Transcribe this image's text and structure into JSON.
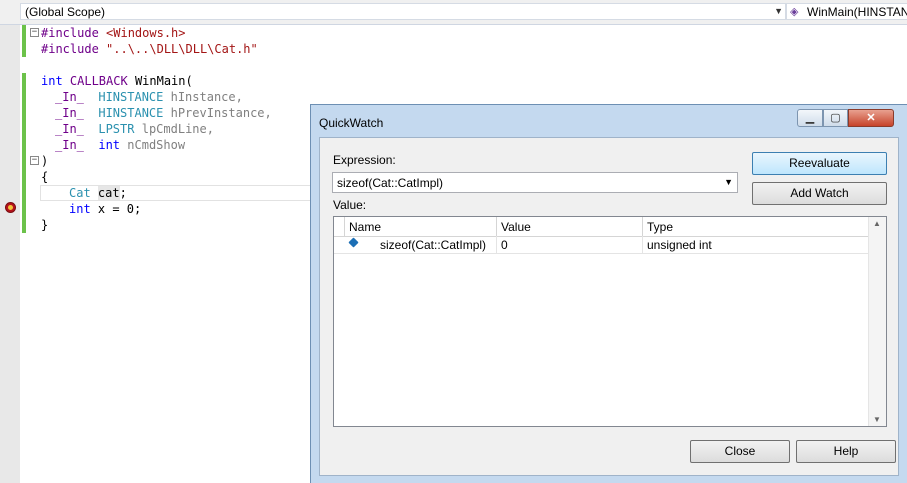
{
  "navbar": {
    "scope": "(Global Scope)",
    "function": "WinMain(HINSTAN"
  },
  "code": {
    "lines": [
      [
        "#include ",
        "<Windows.h>"
      ],
      [
        "#include ",
        "\"..\\..\\DLL\\DLL\\Cat.h\""
      ],
      [
        "int ",
        "CALLBACK ",
        "WinMain("
      ],
      [
        "_In_  ",
        "HINSTANCE ",
        "hInstance,"
      ],
      [
        "_In_  ",
        "HINSTANCE ",
        "hPrevInstance,"
      ],
      [
        "_In_  ",
        "LPSTR ",
        "lpCmdLine,"
      ],
      [
        "_In_  ",
        "int ",
        "nCmdShow"
      ],
      [
        ")"
      ],
      [
        "{"
      ],
      [
        "Cat ",
        "cat",
        ";"
      ],
      [
        "int ",
        "x = 0;"
      ],
      [
        "}"
      ]
    ]
  },
  "quickwatch": {
    "title": "QuickWatch",
    "expression_label": "Expression:",
    "expression_value": "sizeof(Cat::CatImpl)",
    "value_label": "Value:",
    "reevaluate": "Reevaluate",
    "add_watch": "Add Watch",
    "close": "Close",
    "help": "Help",
    "columns": [
      "Name",
      "Value",
      "Type"
    ],
    "rows": [
      {
        "name": "sizeof(Cat::CatImpl)",
        "value": "0",
        "type": "unsigned int"
      }
    ]
  },
  "colors": {
    "keyword": "#0000ff",
    "string": "#a31515",
    "type": "#2b91af",
    "macro": "#6f008a",
    "change_bar": "#6cc24a"
  }
}
